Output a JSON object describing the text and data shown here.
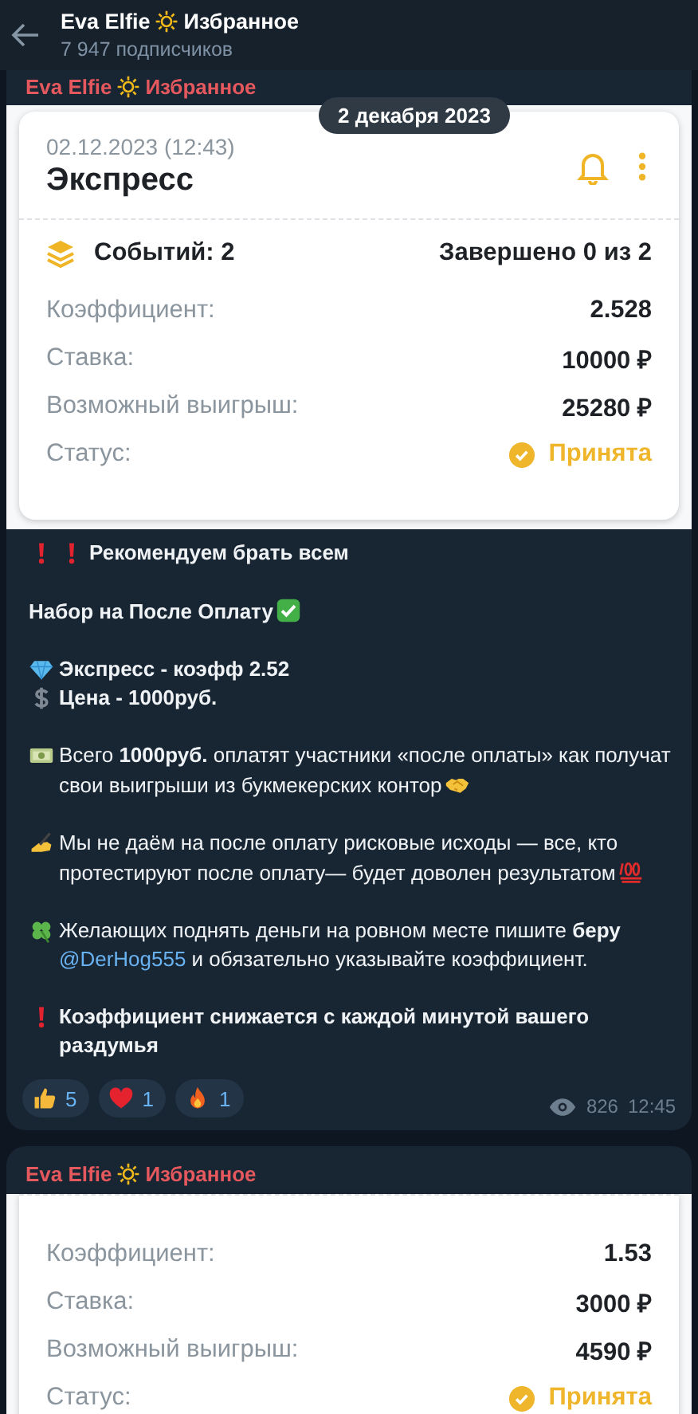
{
  "header": {
    "title": [
      "Eva Elfie",
      "Избранное"
    ],
    "subtitle": "7 947 подписчиков"
  },
  "date_pill": "2 декабря 2023",
  "post": {
    "author": [
      "Eva Elfie",
      "Избранное"
    ],
    "card": {
      "date": "02.12.2023 (12:43)",
      "title": "Экспресс",
      "events": "Событий: 2",
      "finished": "Завершено 0 из 2",
      "rows": [
        {
          "label": "Коэффициент:",
          "value": "2.528"
        },
        {
          "label": "Ставка:",
          "value": "10000 ₽"
        },
        {
          "label": "Возможный выигрыш:",
          "value": "25280 ₽"
        }
      ],
      "status_label": "Статус:",
      "status": "Принята"
    },
    "paragraphs": [
      [
        {
          "text": "Рекомендуем брать всем",
          "bold": true
        }
      ],
      [
        {
          "text": "Набор на После Оплату",
          "bold": true
        }
      ],
      [
        {
          "text": "Экспресс - коэфф 2.52",
          "bold": true
        },
        {
          "text": "Цена - 1000руб.",
          "bold": true
        }
      ],
      [
        {
          "text": "Всего **1000руб.** оплатят участники «после оплаты» как получат свои выигрыши из букмекерских контор",
          "bold": false
        }
      ],
      [
        {
          "text": "Мы не даём на после оплату рисковые исходы — все, кто протестируют после оплату— будет доволен результатом",
          "bold": false
        }
      ],
      [
        {
          "text": "Желающих поднять деньги на ровном месте пишите **беру**",
          "link": "@DerHog555",
          "after": "и обязательно указывайте коэффициент.",
          "bold": false
        }
      ],
      [
        {
          "text": "Коэффициент снижается с каждой минутой вашего раздумья",
          "bold": true
        }
      ]
    ],
    "reactions": [
      {
        "count": "5"
      },
      {
        "count": "1"
      },
      {
        "count": "1"
      }
    ],
    "views": "826",
    "time": "12:45"
  },
  "post2": {
    "author": [
      "Eva Elfie",
      "Избранное"
    ],
    "card": {
      "rows": [
        {
          "label": "Коэффициент:",
          "value": "1.53"
        },
        {
          "label": "Ставка:",
          "value": "3000 ₽"
        },
        {
          "label": "Возможный выигрыш:",
          "value": "4590 ₽"
        }
      ],
      "status_label": "Статус:",
      "status": "Принята"
    }
  }
}
